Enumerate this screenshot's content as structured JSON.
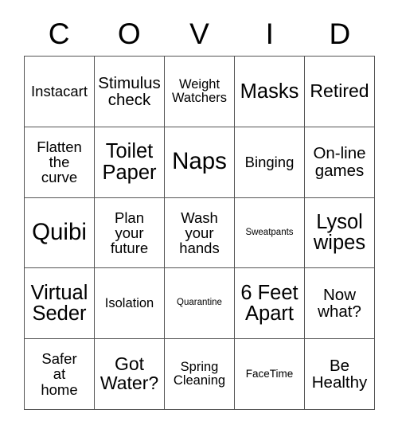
{
  "card": {
    "title_letters": [
      "C",
      "O",
      "V",
      "I",
      "D"
    ],
    "rows": [
      [
        {
          "label": "Instacart",
          "size": "fs-ml"
        },
        {
          "label": "Stimulus\ncheck",
          "size": "fs-lg"
        },
        {
          "label": "Weight\nWatchers",
          "size": "fs-md"
        },
        {
          "label": "Masks",
          "size": "fs-xxl"
        },
        {
          "label": "Retired",
          "size": "fs-xl"
        }
      ],
      [
        {
          "label": "Flatten\nthe\ncurve",
          "size": "fs-ml"
        },
        {
          "label": "Toilet\nPaper",
          "size": "fs-xxl"
        },
        {
          "label": "Naps",
          "size": "fs-huge"
        },
        {
          "label": "Binging",
          "size": "fs-ml"
        },
        {
          "label": "On-line\ngames",
          "size": "fs-lg"
        }
      ],
      [
        {
          "label": "Quibi",
          "size": "fs-huge"
        },
        {
          "label": "Plan\nyour\nfuture",
          "size": "fs-ml"
        },
        {
          "label": "Wash\nyour\nhands",
          "size": "fs-ml"
        },
        {
          "label": "Sweatpants",
          "size": "fs-xs"
        },
        {
          "label": "Lysol\nwipes",
          "size": "fs-xxl"
        }
      ],
      [
        {
          "label": "Virtual\nSeder",
          "size": "fs-xxl"
        },
        {
          "label": "Isolation",
          "size": "fs-md"
        },
        {
          "label": "Quarantine",
          "size": "fs-xs"
        },
        {
          "label": "6 Feet\nApart",
          "size": "fs-xxl"
        },
        {
          "label": "Now\nwhat?",
          "size": "fs-lg"
        }
      ],
      [
        {
          "label": "Safer\nat\nhome",
          "size": "fs-ml"
        },
        {
          "label": "Got\nWater?",
          "size": "fs-xl"
        },
        {
          "label": "Spring\nCleaning",
          "size": "fs-md"
        },
        {
          "label": "FaceTime",
          "size": "fs-sm"
        },
        {
          "label": "Be\nHealthy",
          "size": "fs-lg"
        }
      ]
    ]
  }
}
